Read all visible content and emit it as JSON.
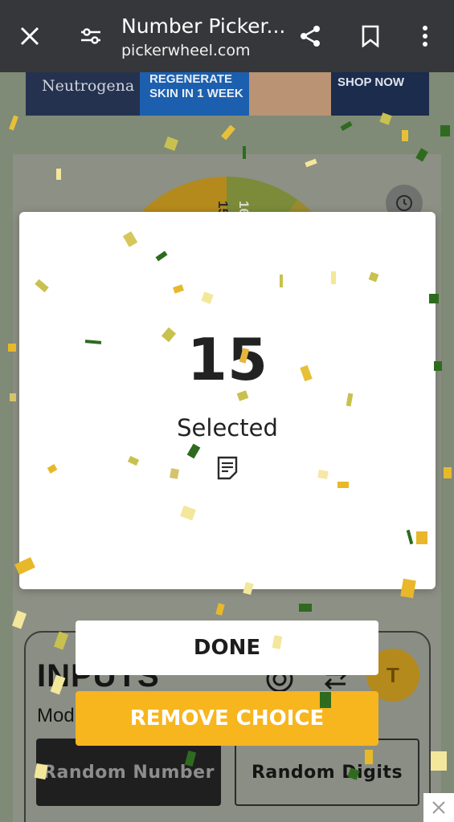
{
  "browser": {
    "title": "Number Picker...",
    "url": "pickerwheel.com",
    "icons": [
      "close-icon",
      "tune-icon",
      "share-icon",
      "bookmark-icon",
      "more-icon"
    ]
  },
  "ad": {
    "brand": "Neutrogena",
    "headline_1": "REGENERATE",
    "headline_2": "SKIN IN 1 WEEK",
    "cta": "SHOP NOW"
  },
  "wheel": {
    "visible_numbers": [
      "15",
      "16"
    ]
  },
  "modal": {
    "result": "15",
    "status": "Selected"
  },
  "buttons": {
    "done": "DONE",
    "remove": "REMOVE CHOICE"
  },
  "inputs_panel": {
    "title": "INPUTS",
    "mode_label": "Mod",
    "avatar_letter": "T",
    "modes": [
      {
        "label": "Random Number",
        "active": true
      },
      {
        "label": "Random Digits",
        "active": false
      }
    ]
  },
  "colors": {
    "accent": "#f7b51e",
    "topbar": "#35373a",
    "confetti_green": "#2e6b1f",
    "confetti_yellow": "#e8c84a"
  }
}
